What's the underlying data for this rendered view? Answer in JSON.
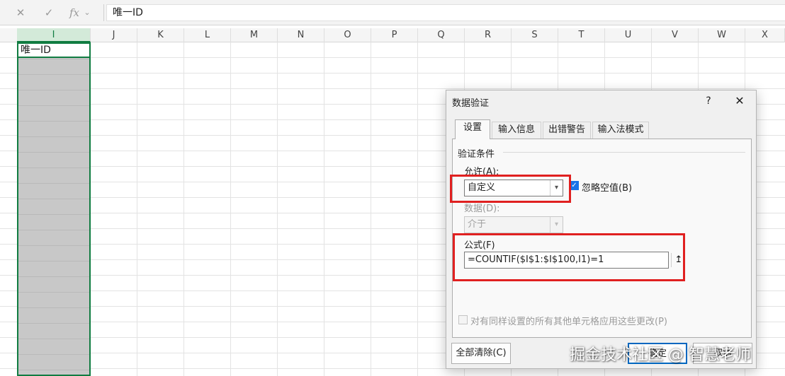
{
  "formula_bar": {
    "cancel_icon": "✕",
    "confirm_icon": "✓",
    "fx_icon": "fx",
    "dropdown_icon": "⌄",
    "content": "唯一ID"
  },
  "sheet": {
    "columns": [
      "I",
      "J",
      "K",
      "L",
      "M",
      "N",
      "O",
      "P",
      "Q",
      "R",
      "S",
      "T",
      "U",
      "V",
      "W",
      "X"
    ],
    "selected_column": "I",
    "active_cell_value": "唯一ID",
    "colors": {
      "selection": "#107c41",
      "selected_fill": "#c8c8c8"
    }
  },
  "dialog": {
    "title": "数据验证",
    "help_label": "?",
    "close_label": "✕",
    "tabs": [
      "设置",
      "输入信息",
      "出错警告",
      "输入法模式"
    ],
    "group_title": "验证条件",
    "allow_label": "允许(A):",
    "allow_value": "自定义",
    "ignore_blank_label": "忽略空值(B)",
    "ignore_blank_checked": true,
    "data_label": "数据(D):",
    "data_value": "介于",
    "formula_label": "公式(F)",
    "formula_value": "=COUNTIF($I$1:$I$100,I1)=1",
    "ref_icon": "↥",
    "apply_all_label": "对有同样设置的所有其他单元格应用这些更改(P)",
    "clear_all_button": "全部清除(C)",
    "ok_button": "确定",
    "cancel_button": "取消"
  },
  "watermark": "掘金技术社区 @ 智慧老师",
  "highlight_color": "#e02020"
}
